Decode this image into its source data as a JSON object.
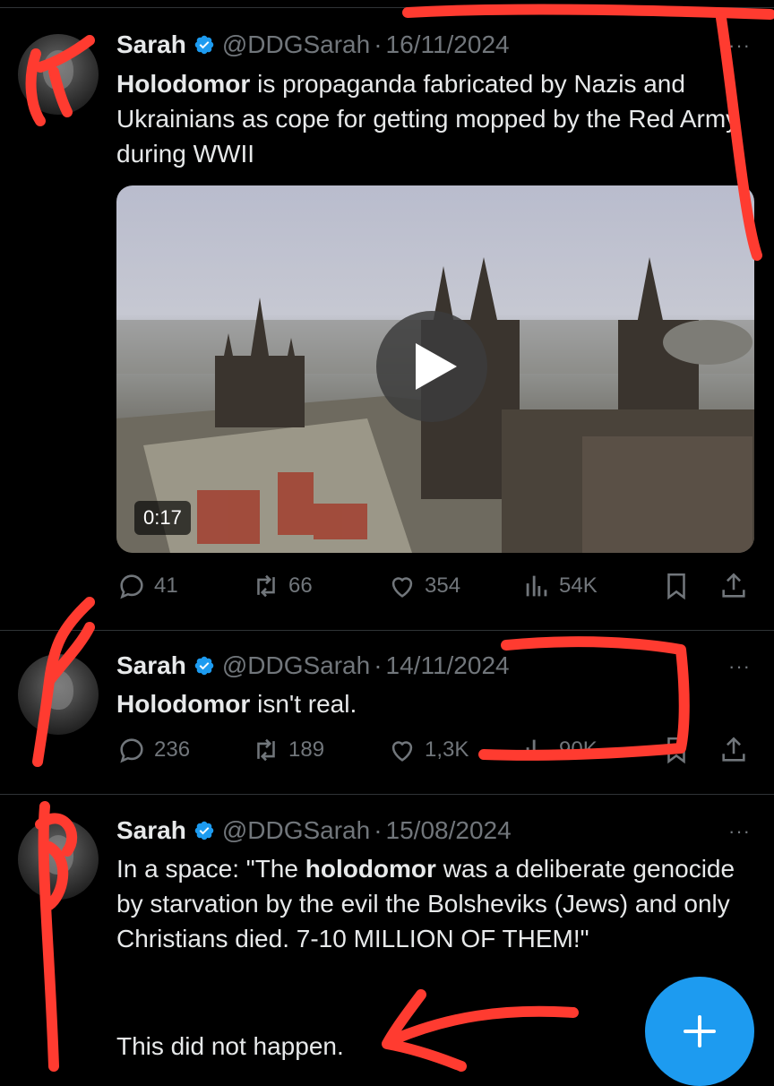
{
  "tweets": [
    {
      "name": "Sarah",
      "handle": "@DDGSarah",
      "separator": "·",
      "date": "16/11/2024",
      "more": "···",
      "text_bold": "Holodomor",
      "text_rest": " is propaganda fabricated by Nazis and Ukrainians as cope for getting mopped by the Red Army during WWII",
      "video_duration": "0:17",
      "replies": "41",
      "reposts": "66",
      "likes": "354",
      "views": "54K"
    },
    {
      "name": "Sarah",
      "handle": "@DDGSarah",
      "separator": "·",
      "date": "14/11/2024",
      "more": "···",
      "text_bold": "Holodomor",
      "text_rest": " isn't real.",
      "replies": "236",
      "reposts": "189",
      "likes": "1,3K",
      "views": "90K"
    },
    {
      "name": "Sarah",
      "handle": "@DDGSarah",
      "separator": "·",
      "date": "15/08/2024",
      "more": "···",
      "text_pre": "In a space: \"The ",
      "text_bold": "holodomor",
      "text_rest": " was a deliberate genocide by starvation by the evil the Bolsheviks (Jews) and only Christians died. 7-10 MILLION OF THEM!\"",
      "text_after": "This did not happen."
    }
  ],
  "fab_label": "+",
  "colors": {
    "accent": "#1d9bf0",
    "annotation": "#ff3b30",
    "muted": "#71767b"
  }
}
